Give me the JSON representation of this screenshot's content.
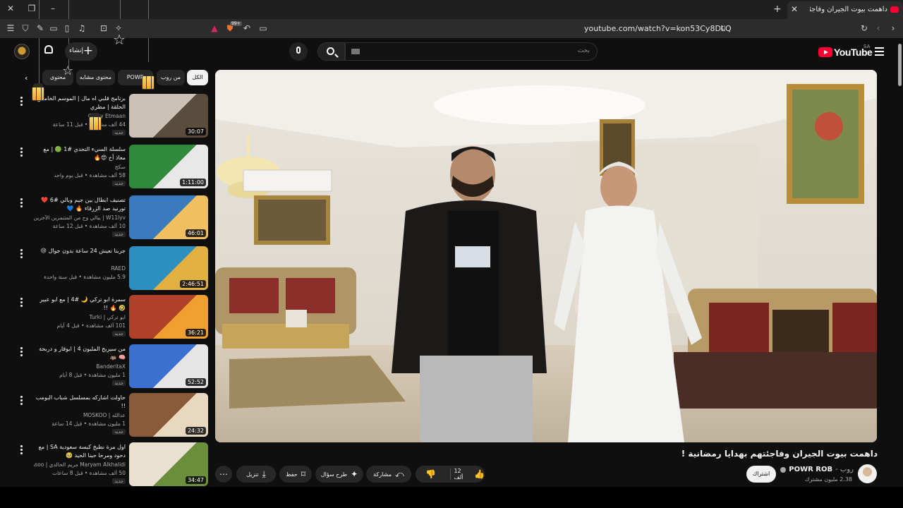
{
  "browser": {
    "tab_title": "داهمت بيوت الجيران وفاجئتهم ب",
    "url": "youtube.com/watch?v=kon53Cy8DLQ",
    "shield_badge": "99+"
  },
  "header": {
    "logo_text": "YouTube",
    "country_code": "SA",
    "search_placeholder": "بحث",
    "create_label": "إنشاء"
  },
  "video": {
    "title": "داهمت بيوت الجيران وفاجئتهم بهدايا رمضانية !",
    "channel": "POWR ROB",
    "channel_owner": "روب -",
    "subscribers": "2.38 مليون مشترك",
    "subscribe_label": "اشتراك",
    "likes": "12 ألف",
    "share_label": "مشاركة",
    "ask_label": "طرح سؤال",
    "save_label": "حفظ",
    "download_label": "تنزيل"
  },
  "chips": [
    "الكل",
    "من روب",
    "POWR",
    "محتوى مشابه",
    "محتوى"
  ],
  "recommendations": [
    {
      "title": "برنامج قلبي اه مال | الموسم الخامس الحلقة | مطري",
      "channel": "Qalby Etmaan",
      "meta": "44 ألف مشاهدة • قبل 11 ساعة",
      "badge": "جديد",
      "duration": "30:07"
    },
    {
      "title": "سلسلة السيء التحدي #1 🟢 | مع معاذ أخ 😍🔥",
      "channel": "سكج",
      "meta": "58 ألف مشاهدة • قبل يوم واحد",
      "badge": "جديد",
      "duration": "1:11:00"
    },
    {
      "title": "تصنيف ابطال بين جيم وبالي #6 ❤️ تورنيد صد الزرقاء 🔥 💙",
      "channel": "W11lyv | يبالي وج من المتنمرين الآخرين",
      "meta": "10 ألف مشاهدة • قبل 12 ساعة",
      "badge": "جديد",
      "duration": "46:01"
    },
    {
      "title": "جربنا نعيش 24 ساعة بدون جوال 😢",
      "channel": "RAED",
      "meta": "5.9 مليون مشاهدة • قبل سنة واحدة",
      "badge": "",
      "duration": "2:46:51"
    },
    {
      "title": "سمرة ابو تركي 🌙 #4 | مع ابو عبير 🤣 🔥 !!",
      "channel": "ابو تركي | Turki",
      "meta": "101 ألف مشاهدة • قبل 4 أيام",
      "badge": "جديد",
      "duration": "36:21"
    },
    {
      "title": "من سيربح الملبون 4 | ابوقار و دربحة 🧠 🦛",
      "channel": "BanderitaX",
      "meta": "1 مليون مشاهدة • قبل 8 أيام",
      "badge": "جديد",
      "duration": "52:52"
    },
    {
      "title": "حاولت اشاركه بمسلسل شباب البومب !!",
      "channel": "عدالله | MOSKOO",
      "meta": "1 مليون مشاهدة • قبل 14 ساعة",
      "badge": "جديد",
      "duration": "24:32"
    },
    {
      "title": "اول مرة نطبخ كبسة سعودية SA | مع دحود ومرحا حبنا الحيد 🥹",
      "channel": "Maryam Alkhalidi مريم الخالدي | Asoo اسو",
      "meta": "50 ألف مشاهدة • قبل 8 ساعات",
      "badge": "جديد",
      "duration": "34:47"
    }
  ],
  "colors": {
    "background": "#0f0f0f",
    "chip_bg": "#272727",
    "brand_red": "#ff0033"
  }
}
